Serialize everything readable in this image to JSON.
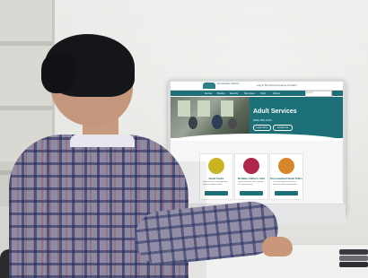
{
  "screen": {
    "logo_text": "Hometown Library",
    "top_links": "Log in   My Account   Hours   Contact",
    "search_placeholder": "Search",
    "nav_items": [
      "Home",
      "Books",
      "Events",
      "Services",
      "Visit",
      "About"
    ],
    "hero_title": "Adult Services",
    "hero_phone": "(555) 555-1234",
    "hero_buttons": [
      "Learn More",
      "Contact Us"
    ],
    "cards": [
      {
        "title": "Book Clubs",
        "body": "Join one of our reading groups and meet fellow readers",
        "color": "#c9b522"
      },
      {
        "title": "Notable Authors Visit",
        "body": "Upcoming author talks, signings and special guests",
        "color": "#b0274c"
      },
      {
        "title": "Personalized Book Picks",
        "body": "Tell us what you like and our librarians will recommend titles",
        "color": "#d7852a"
      }
    ]
  },
  "colors": {
    "accent": "#1d7078",
    "nav": "#1f6f78"
  }
}
